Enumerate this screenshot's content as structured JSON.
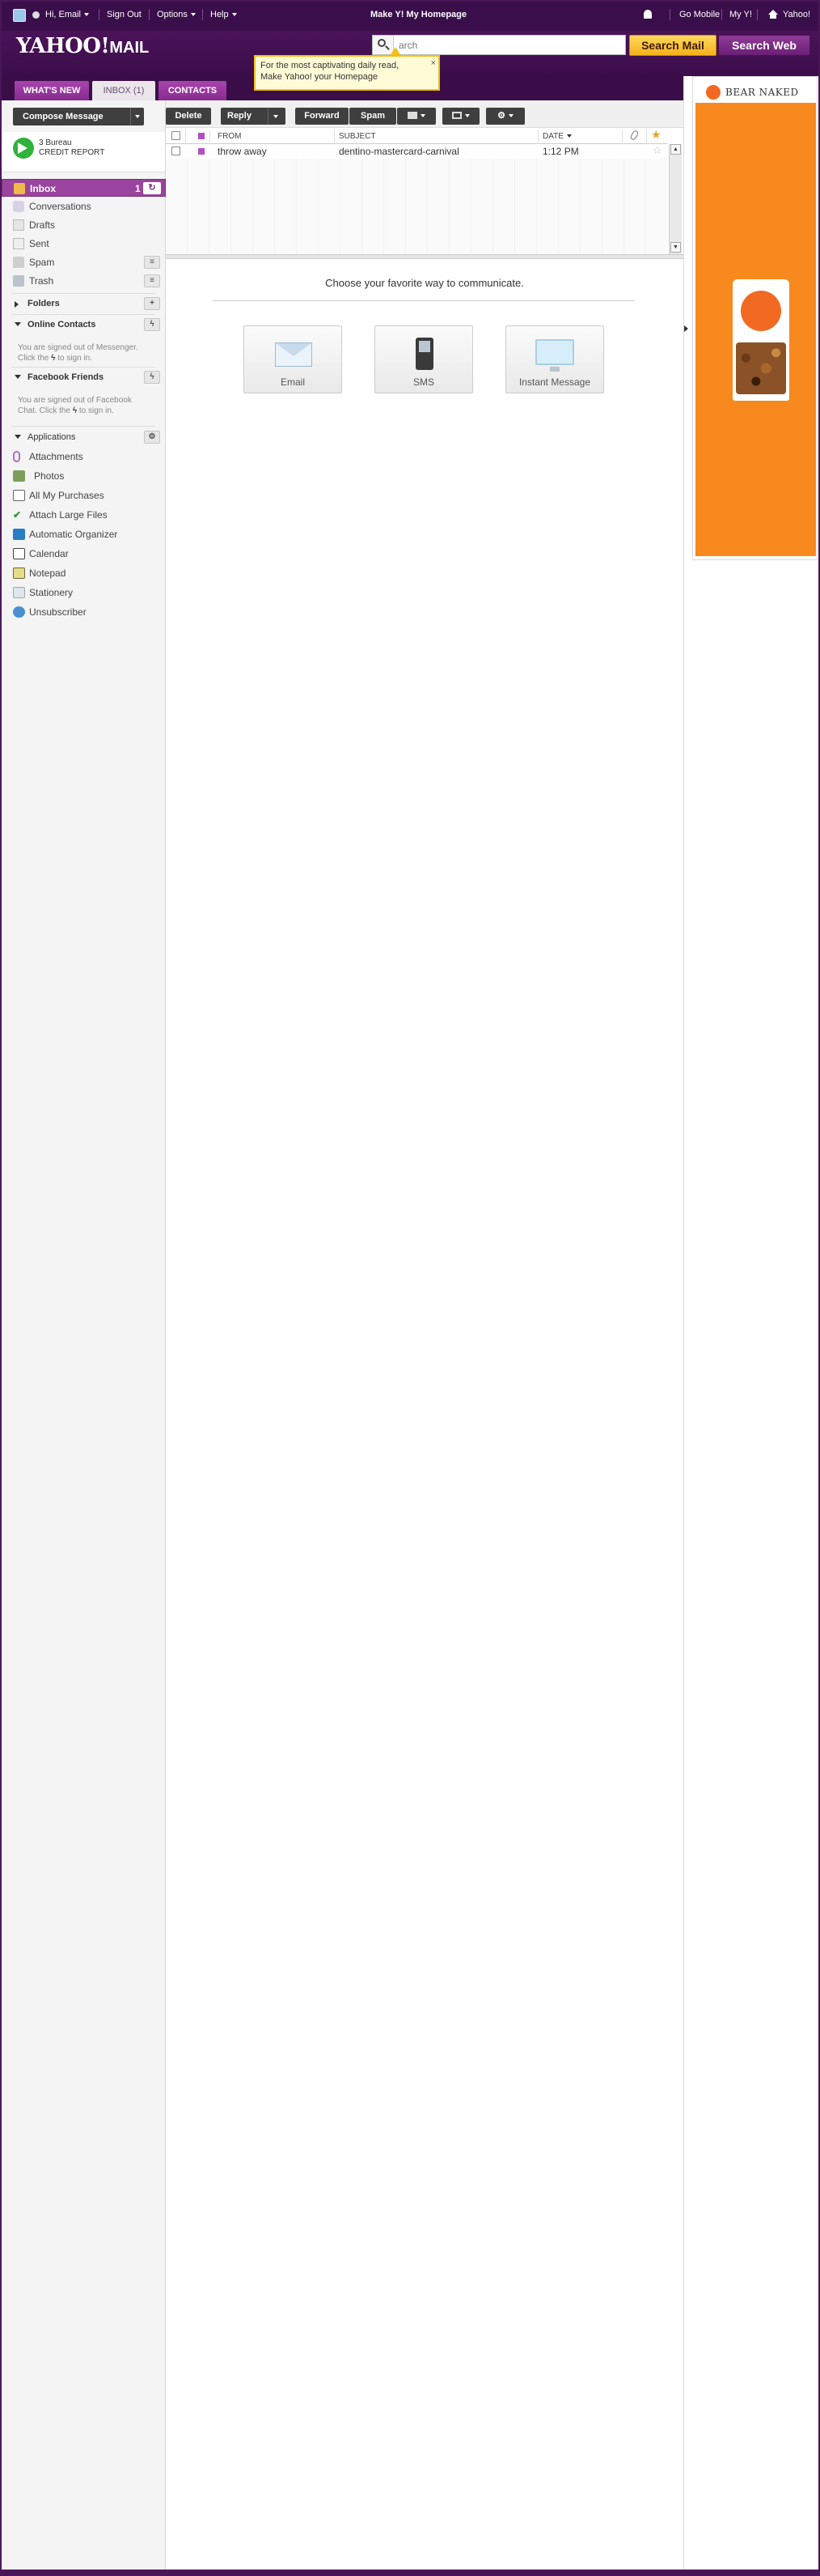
{
  "topbar": {
    "greeting": "Hi, Email",
    "sign_out": "Sign Out",
    "options": "Options",
    "help": "Help",
    "homepage_promo": "Make Y! My Homepage",
    "go_mobile": "Go Mobile",
    "my_y": "My Y!",
    "yahoo": "Yahoo!"
  },
  "header": {
    "logo_main": "YAHOO!",
    "logo_sub": "MAIL",
    "search_placeholder": "arch",
    "search_mail": "Search Mail",
    "search_web": "Search Web"
  },
  "tooltip": {
    "line1": "For the most captivating daily read,",
    "line2": "Make Yahoo! your Homepage",
    "close": "×"
  },
  "tabs": [
    {
      "label": "WHAT'S NEW"
    },
    {
      "label": "INBOX (1)"
    },
    {
      "label": "CONTACTS"
    }
  ],
  "sidebar": {
    "compose": "Compose Message",
    "promo": {
      "line1": "3 Bureau",
      "line2": "CREDIT REPORT"
    },
    "inbox": {
      "label": "Inbox",
      "count": "1"
    },
    "items": [
      {
        "label": "Conversations"
      },
      {
        "label": "Drafts"
      },
      {
        "label": "Sent"
      },
      {
        "label": "Spam"
      },
      {
        "label": "Trash"
      }
    ],
    "folders": "Folders",
    "online_contacts": "Online Contacts",
    "messenger_note_1": "You are signed out of Messenger.",
    "messenger_note_2": "Click the",
    "messenger_note_3": "to sign in.",
    "facebook_friends": "Facebook Friends",
    "fb_note_1": "You are signed out of Facebook",
    "fb_note_2": "Chat. Click the",
    "fb_note_3": "to sign in.",
    "applications": "Applications",
    "apps": [
      {
        "label": "Attachments"
      },
      {
        "label": "Photos"
      },
      {
        "label": "All My Purchases"
      },
      {
        "label": "Attach Large Files"
      },
      {
        "label": "Automatic Organizer"
      },
      {
        "label": "Calendar"
      },
      {
        "label": "Notepad"
      },
      {
        "label": "Stationery"
      },
      {
        "label": "Unsubscriber"
      }
    ]
  },
  "toolbar": {
    "delete": "Delete",
    "reply": "Reply",
    "forward": "Forward",
    "spam": "Spam"
  },
  "message_list": {
    "columns": {
      "from": "FROM",
      "subject": "SUBJECT",
      "date": "DATE"
    },
    "rows": [
      {
        "from": "throw away",
        "subject": "dentino-mastercard-carnival",
        "date": "1:12 PM"
      }
    ]
  },
  "preview": {
    "choose": "Choose your favorite way to communicate.",
    "options": [
      {
        "label": "Email"
      },
      {
        "label": "SMS"
      },
      {
        "label": "Instant Message"
      }
    ]
  },
  "ad": {
    "brand": "BEAR NAKED"
  },
  "colors": {
    "brand_purple": "#3a0e4a",
    "accent_purple": "#9a449d",
    "search_mail_yellow": "#f3b21a",
    "ad_orange": "#f7891f"
  }
}
